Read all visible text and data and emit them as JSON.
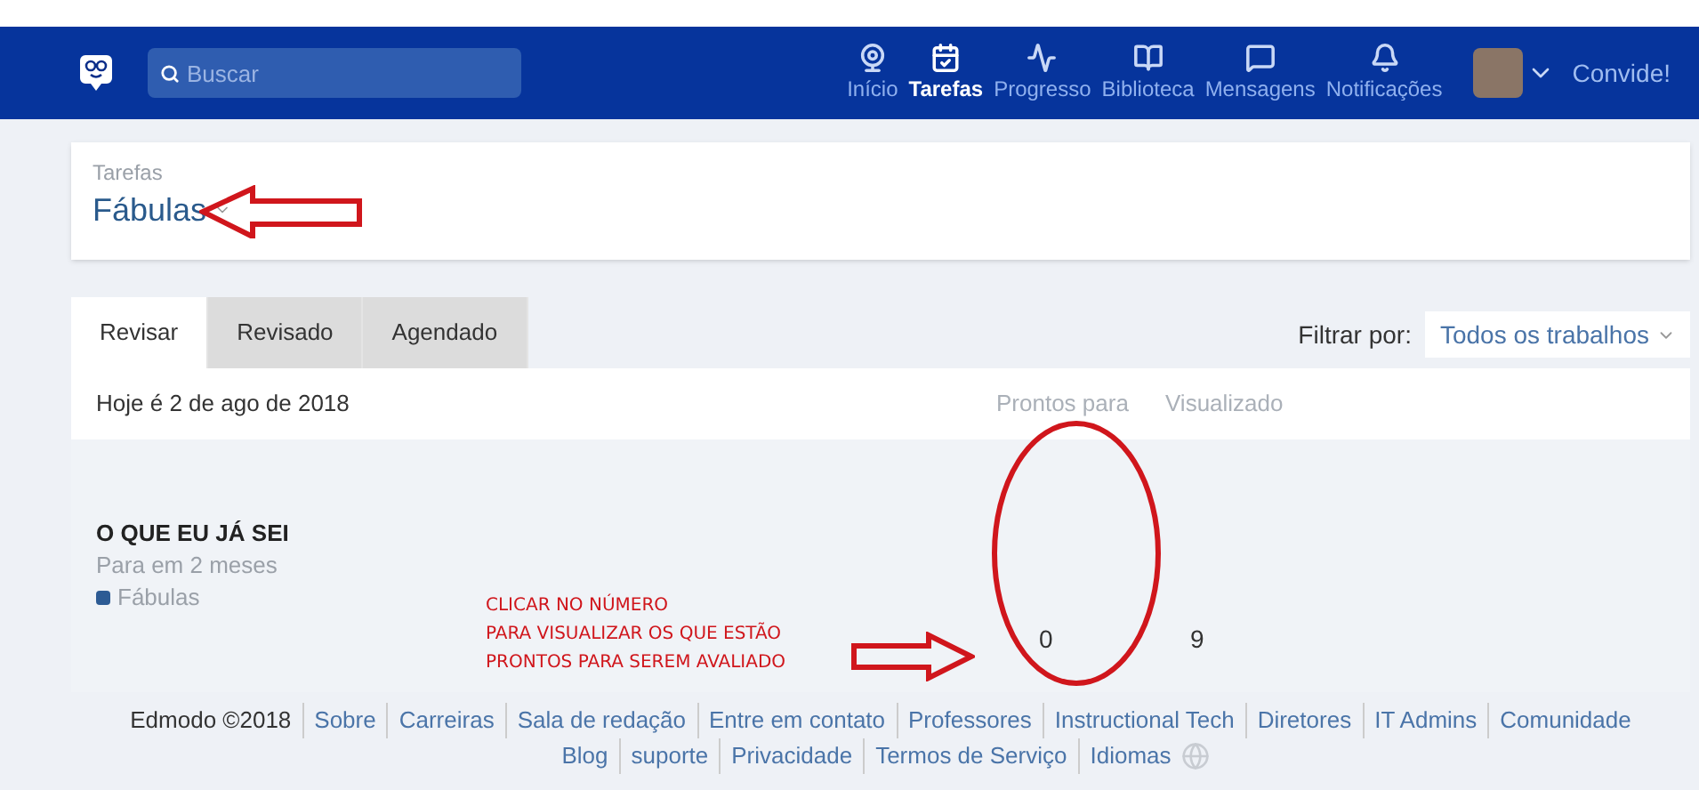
{
  "nav": {
    "search": {
      "placeholder": "Buscar"
    },
    "items": [
      {
        "label": "Início",
        "selected": false
      },
      {
        "label": "Tarefas",
        "selected": true
      },
      {
        "label": "Progresso",
        "selected": false
      },
      {
        "label": "Biblioteca",
        "selected": false
      },
      {
        "label": "Mensagens",
        "selected": false
      },
      {
        "label": "Notificações",
        "selected": false
      }
    ],
    "invite": "Convide!"
  },
  "header": {
    "breadcrumb": "Tarefas",
    "title": "Fábulas"
  },
  "tabs": [
    {
      "label": "Revisar",
      "selected": true
    },
    {
      "label": "Revisado",
      "selected": false
    },
    {
      "label": "Agendado",
      "selected": false
    }
  ],
  "filter": {
    "label": "Filtrar por:",
    "value": "Todos os trabalhos"
  },
  "table": {
    "date": "Hoje é 2 de ago de 2018",
    "columns": [
      "Prontos para",
      "Visualizado"
    ],
    "rows": [
      {
        "title": "O QUE EU JÁ SEI",
        "due": "Para em 2 meses",
        "tag": "Fábulas",
        "color": "#2d5b94",
        "values": [
          "0",
          "9"
        ]
      }
    ]
  },
  "annotation": {
    "lines": [
      "CLICAR NO NÚMERO",
      "PARA VISUALIZAR OS QUE ESTÃO",
      "PRONTOS PARA SEREM AVALIADO"
    ]
  },
  "footer": {
    "copyright": "Edmodo ©2018",
    "links": [
      "Sobre",
      "Carreiras",
      "Sala de redação",
      "Entre em contato",
      "Professores",
      "Instructional Tech",
      "Diretores",
      "IT Admins",
      "Comunidade"
    ],
    "links_2": [
      "Blog",
      "suporte",
      "Privacidade",
      "Termos de Serviço",
      "Idiomas"
    ]
  }
}
